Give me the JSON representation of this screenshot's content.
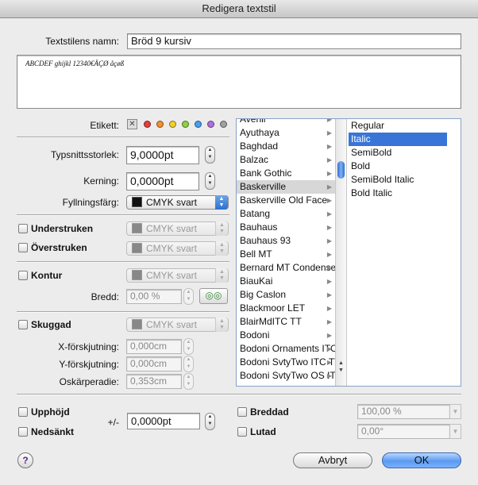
{
  "window": {
    "title": "Redigera textstil"
  },
  "name_label": "Textstilens namn:",
  "name_value": "Bröd 9 kursiv",
  "preview_text": "ABCDEF ghijkl 12340€ÄÇØ åçøß",
  "etikett_label": "Etikett:",
  "label_colors": [
    "#e04040",
    "#f39030",
    "#f0d030",
    "#8ed040",
    "#4a9ef0",
    "#b070d8",
    "#a0a0a0"
  ],
  "font_size": {
    "label": "Typsnittsstorlek:",
    "value": "9,0000pt"
  },
  "kerning": {
    "label": "Kerning:",
    "value": "0,0000pt"
  },
  "fill": {
    "label": "Fyllningsfärg:",
    "value": "CMYK svart"
  },
  "underline": {
    "label": "Understruken",
    "color": "CMYK svart"
  },
  "strikethrough": {
    "label": "Överstruken",
    "color": "CMYK svart"
  },
  "outline": {
    "label": "Kontur",
    "color": "CMYK svart",
    "width_label": "Bredd:",
    "width_value": "0,00 %"
  },
  "shadow": {
    "label": "Skuggad",
    "color": "CMYK svart",
    "x_label": "X-förskjutning:",
    "x_value": "0,000cm",
    "y_label": "Y-förskjutning:",
    "y_value": "0,000cm",
    "blur_label": "Oskärperadie:",
    "blur_value": "0,353cm"
  },
  "fonts": [
    "Avenir",
    "Ayuthaya",
    "Baghdad",
    "Balzac",
    "Bank Gothic",
    "Baskerville",
    "Baskerville Old Face",
    "Batang",
    "Bauhaus",
    "Bauhaus 93",
    "Bell MT",
    "Bernard MT Condensed",
    "BiauKai",
    "Big Caslon",
    "Blackmoor LET",
    "BlairMdITC TT",
    "Bodoni",
    "Bodoni Ornaments ITC",
    "Bodoni SvtyTwo ITC TT",
    "Bodoni SvtyTwo OS ITC TT"
  ],
  "font_selected": "Baskerville",
  "styles": [
    "Regular",
    "Italic",
    "SemiBold",
    "Bold",
    "SemiBold Italic",
    "Bold Italic"
  ],
  "style_selected": "Italic",
  "superscript": {
    "label": "Upphöjd"
  },
  "subscript": {
    "label": "Nedsänkt"
  },
  "baseline": {
    "label": "+/-",
    "value": "0,0000pt"
  },
  "widened": {
    "label": "Breddad",
    "value": "100,00 %"
  },
  "slanted": {
    "label": "Lutad",
    "value": "0,00°"
  },
  "buttons": {
    "help": "?",
    "cancel": "Avbryt",
    "ok": "OK"
  }
}
